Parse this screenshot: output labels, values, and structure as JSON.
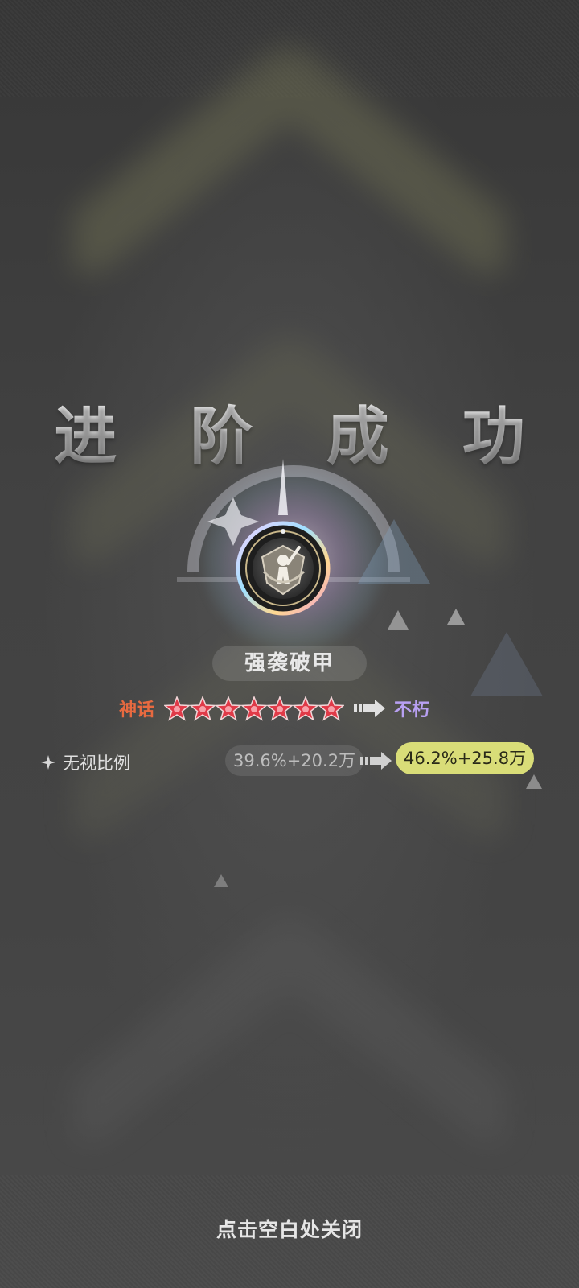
{
  "title": "进 阶 成 功",
  "skill": {
    "name": "强袭破甲",
    "icon": "armor-break-skill-icon"
  },
  "grade": {
    "from": "神话",
    "stars": 7,
    "to": "不朽"
  },
  "stat": {
    "label": "无视比例",
    "old_value": "39.6%+20.2万",
    "new_value": "46.2%+25.8万"
  },
  "close_hint": "点击空白处关闭",
  "colors": {
    "grade_from": "#e86a40",
    "grade_to": "#b8a0f2",
    "new_value_bg": "#d9dd78",
    "star_fill": "#e03a48"
  }
}
